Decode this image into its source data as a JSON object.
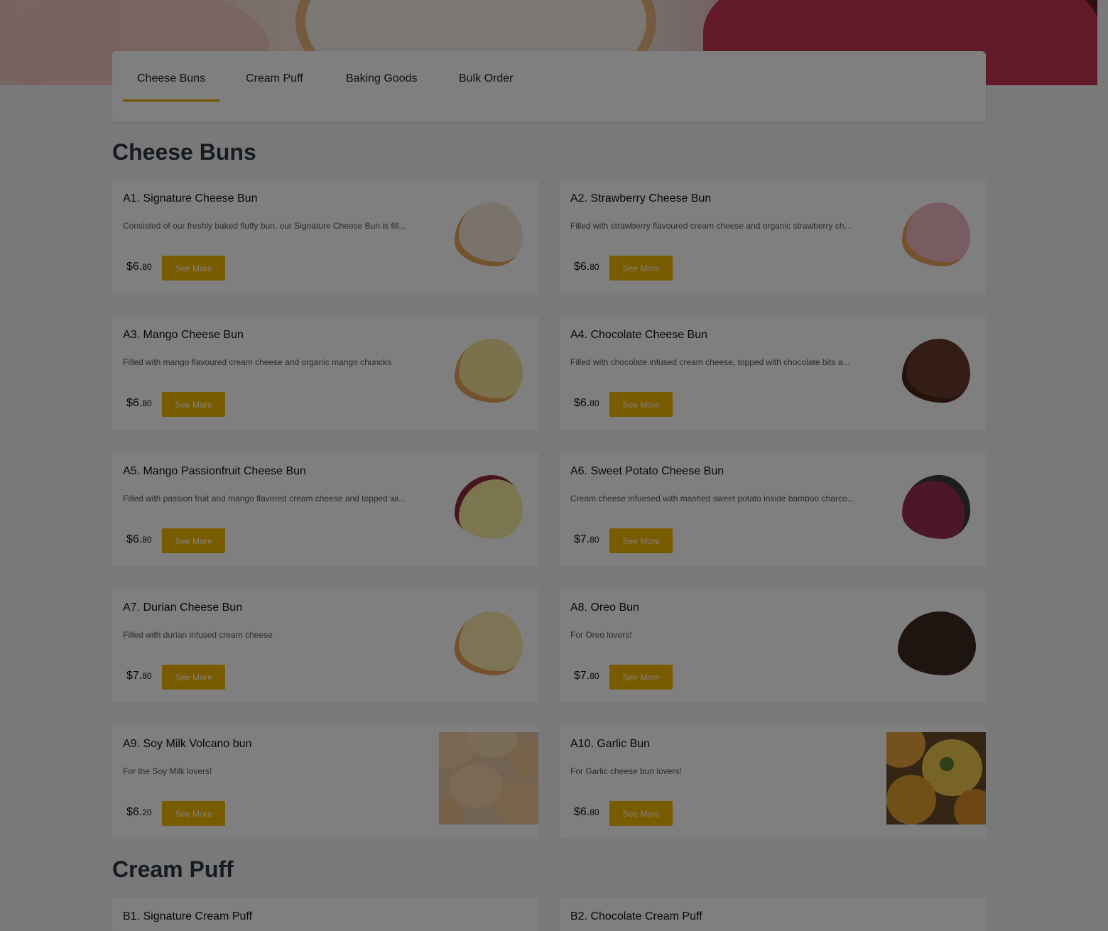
{
  "tabs": [
    {
      "label": "Cheese Buns"
    },
    {
      "label": "Cream Puff"
    },
    {
      "label": "Baking Goods"
    },
    {
      "label": "Bulk Order"
    }
  ],
  "sections": [
    {
      "title": "Cheese Buns"
    },
    {
      "title": "Cream Puff"
    }
  ],
  "button_label": "See More",
  "accent_color": "#f5b800",
  "products": [
    {
      "name": "A1. Signature Cheese Bun",
      "desc": "Consisted of our freshly baked fluffy bun, our Signature Cheese Bun is fill...",
      "dollars": "$6.",
      "cents": "80",
      "image": "signature-cheese-bun-image",
      "color": "#f3e7d6"
    },
    {
      "name": "A2. Strawberry Cheese Bun",
      "desc": "Filled with strawberry flavoured cream cheese and organic strawberry chu...",
      "dollars": "$6.",
      "cents": "80",
      "image": "strawberry-cheese-bun-image",
      "color": "#f2b8c4"
    },
    {
      "name": "A3. Mango Cheese Bun",
      "desc": "Filled with mango flavoured cream cheese and organic mango chuncks",
      "dollars": "$6.",
      "cents": "80",
      "image": "mango-cheese-bun-image",
      "color": "#f6e29a"
    },
    {
      "name": "A4. Chocolate Cheese Bun",
      "desc": "Filled with chocolate infused cream cheese, topped with chocolate bits a...",
      "dollars": "$6.",
      "cents": "80",
      "image": "chocolate-cheese-bun-image",
      "color": "#6b3a2e"
    },
    {
      "name": "A5. Mango Passionfruit Cheese Bun",
      "desc": "Filled with passion fruit and mango flavored cream cheese and topped wi...",
      "dollars": "$6.",
      "cents": "80",
      "image": "mango-passionfruit-cheese-bun-image",
      "color": "#f7ec9e"
    },
    {
      "name": "A6. Sweet Potato Cheese Bun",
      "desc": "Cream cheese infuesed with mashed sweet potato inside bamboo charco...",
      "dollars": "$7.",
      "cents": "80",
      "image": "sweet-potato-cheese-bun-image",
      "color": "#9b2f4e"
    },
    {
      "name": "A7. Durian Cheese Bun",
      "desc": "Filled with durian infused cream cheese",
      "dollars": "$7.",
      "cents": "80",
      "image": "durian-cheese-bun-image",
      "color": "#f8e9a8"
    },
    {
      "name": "A8. Oreo Bun",
      "desc": "For Oreo lovers!",
      "dollars": "$7.",
      "cents": "80",
      "image": "oreo-bun-image",
      "color": "#3d2a22"
    },
    {
      "name": "A9. Soy Milk Volcano bun",
      "desc": "For the Soy Milk lovers!",
      "dollars": "$6.",
      "cents": "20",
      "image": "soy-milk-volcano-bun-image",
      "color": "#f3c79a"
    },
    {
      "name": "A10. Garlic Bun",
      "desc": "For Garlic cheese bun lovers!",
      "dollars": "$6.",
      "cents": "80",
      "image": "garlic-bun-image",
      "color": "#e3a030"
    },
    {
      "name": "B1. Signature Cream Puff",
      "desc": "",
      "dollars": "",
      "cents": "",
      "image": "",
      "color": ""
    },
    {
      "name": "B2. Chocolate Cream Puff",
      "desc": "",
      "dollars": "",
      "cents": "",
      "image": "",
      "color": ""
    }
  ]
}
